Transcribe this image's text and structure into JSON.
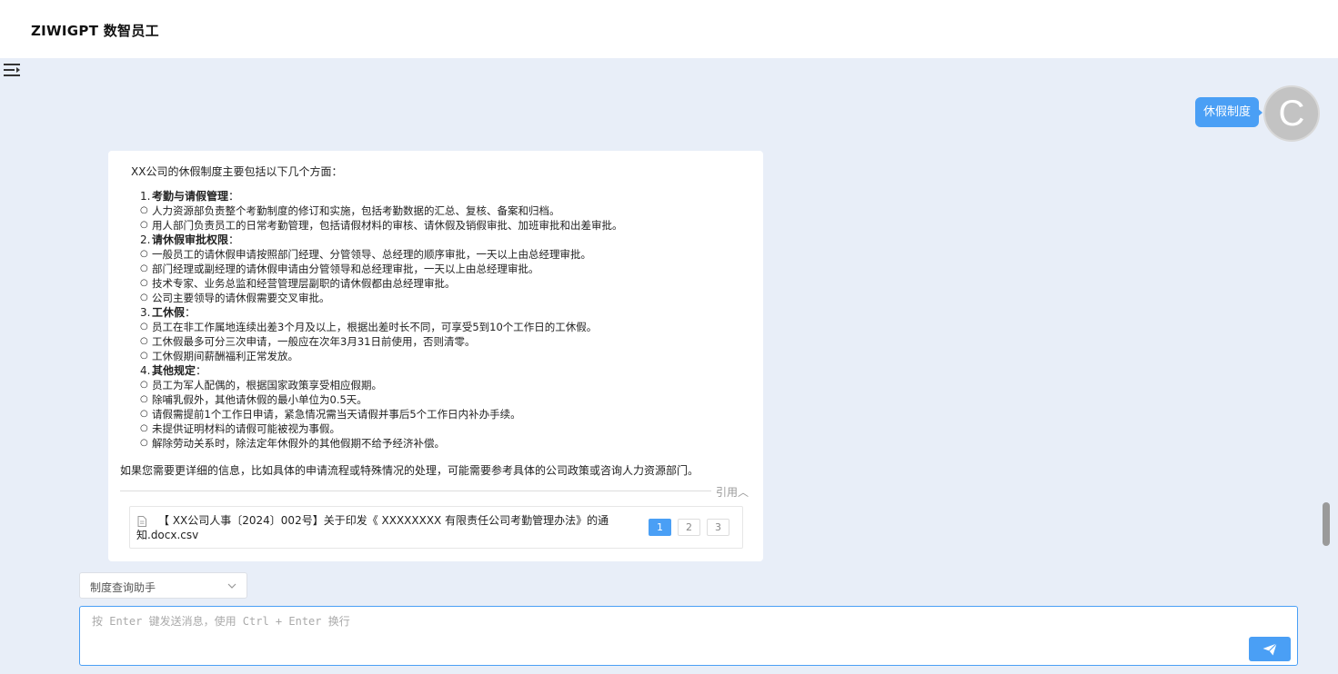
{
  "header": {
    "brand": "ZIWIGPT 数智员工"
  },
  "icons": {
    "menu": "menu-collapse-icon",
    "send": "paper-plane-icon",
    "doc": "document-icon",
    "chevron": "chevron-down-icon"
  },
  "colors": {
    "accent": "#4a9ff5",
    "background": "#e8eef8",
    "avatar": "#c3c3c3"
  },
  "user_message": {
    "text": "休假制度",
    "avatar_letter": "C"
  },
  "assistant_message": {
    "intro": "XX公司的休假制度主要包括以下几个方面：",
    "sections": [
      {
        "num": "1.",
        "title": "考勤与请假管理",
        "suffix": "：",
        "items": [
          "人力资源部负责整个考勤制度的修订和实施，包括考勤数据的汇总、复核、备案和归档。",
          "用人部门负责员工的日常考勤管理，包括请假材料的审核、请休假及销假审批、加班审批和出差审批。"
        ]
      },
      {
        "num": "2.",
        "title": "请休假审批权限",
        "suffix": "：",
        "items": [
          "一般员工的请休假申请按照部门经理、分管领导、总经理的顺序审批，一天以上由总经理审批。",
          "部门经理或副经理的请休假申请由分管领导和总经理审批，一天以上由总经理审批。",
          "技术专家、业务总监和经营管理层副职的请休假都由总经理审批。",
          "公司主要领导的请休假需要交叉审批。"
        ]
      },
      {
        "num": "3.",
        "title": "工休假",
        "suffix": "：",
        "items": [
          "员工在非工作属地连续出差3个月及以上，根据出差时长不同，可享受5到10个工作日的工休假。",
          "工休假最多可分三次申请，一般应在次年3月31日前使用，否则清零。",
          "工休假期间薪酬福利正常发放。"
        ]
      },
      {
        "num": "4.",
        "title": "其他规定",
        "suffix": "：",
        "items": [
          "员工为军人配偶的，根据国家政策享受相应假期。",
          "除哺乳假外，其他请休假的最小单位为0.5天。",
          "请假需提前1个工作日申请，紧急情况需当天请假并事后5个工作日内补办手续。",
          "未提供证明材料的请假可能被视为事假。",
          "解除劳动关系时，除法定年休假外的其他假期不给予经济补偿。"
        ]
      }
    ],
    "footer": "如果您需要更详细的信息，比如具体的申请流程或特殊情况的处理，可能需要参考具体的公司政策或咨询人力资源部门。",
    "citation": {
      "toggle": "引用︿",
      "text": "【 XX公司人事〔2024〕002号】关于印发《 XXXXXXXX 有限责任公司考勤管理办法》的通知.docx.csv",
      "pages": [
        "1",
        "2",
        "3"
      ],
      "active_page": "1"
    }
  },
  "agent_select": {
    "value": "制度查询助手"
  },
  "composer": {
    "placeholder": "按 Enter 键发送消息，使用 Ctrl + Enter 换行",
    "value": ""
  }
}
